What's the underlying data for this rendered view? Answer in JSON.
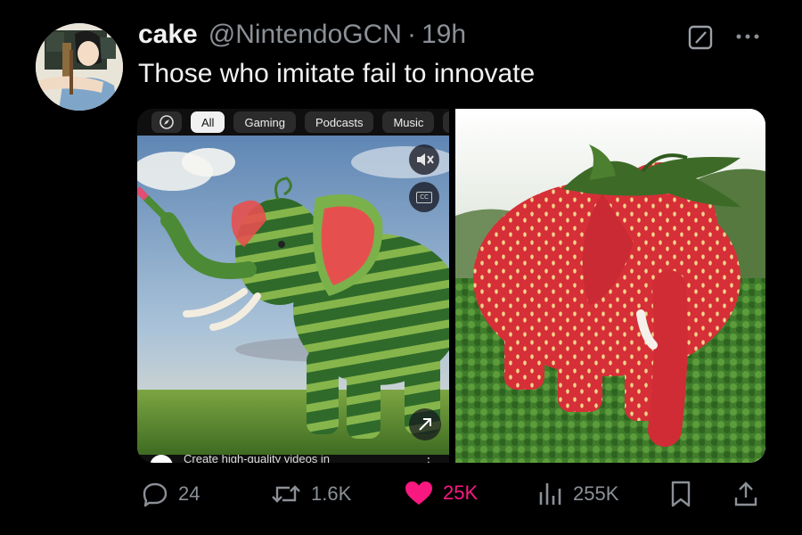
{
  "post": {
    "display_name": "cake",
    "handle": "@NintendoGCN",
    "separator": "·",
    "time": "19h",
    "text": "Those who imitate fail to innovate"
  },
  "media_left": {
    "chips": [
      "All",
      "Gaming",
      "Podcasts",
      "Music",
      "T"
    ],
    "active_chip": "All",
    "footer_text": "Create high-quality videos in",
    "cc_label": "CC",
    "controls": [
      "mute-icon",
      "closed-captions-icon",
      "expand-icon",
      "more-vertical-icon"
    ]
  },
  "media_right": {
    "subject": "strawberry-elephant"
  },
  "actions": {
    "replies": "24",
    "reposts": "1.6K",
    "likes": "25K",
    "views": "255K"
  },
  "colors": {
    "background": "#000000",
    "text": "#e7e9ea",
    "muted": "#8b9096",
    "like": "#f91880"
  },
  "icons": [
    "grok-icon",
    "more-horizontal-icon",
    "reply-icon",
    "repost-icon",
    "heart-icon",
    "views-icon",
    "bookmark-icon",
    "share-icon"
  ]
}
